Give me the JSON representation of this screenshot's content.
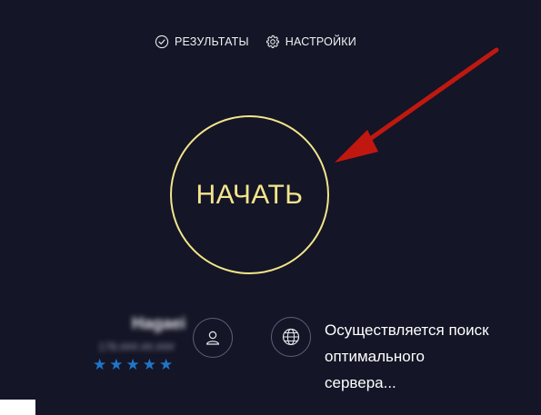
{
  "nav": {
    "results_label": "РЕЗУЛЬТАТЫ",
    "settings_label": "НАСТРОЙКИ",
    "results_icon": "check-circle-icon",
    "settings_icon": "gear-icon"
  },
  "start_button": {
    "label": "НАЧАТЬ"
  },
  "provider": {
    "name": "Hagaei",
    "ip": "178.###.##.###",
    "rating": "★★★★★",
    "rating_value": 5
  },
  "icons": {
    "user": "user-icon",
    "globe": "globe-icon",
    "arrow": "red-arrow-icon"
  },
  "status": {
    "line1": "Осуществляется поиск",
    "line2": "оптимального",
    "line3": "сервера..."
  },
  "colors": {
    "background": "#141526",
    "accent": "#f2e58b",
    "star": "#1f76c8",
    "arrow": "#c01810"
  }
}
